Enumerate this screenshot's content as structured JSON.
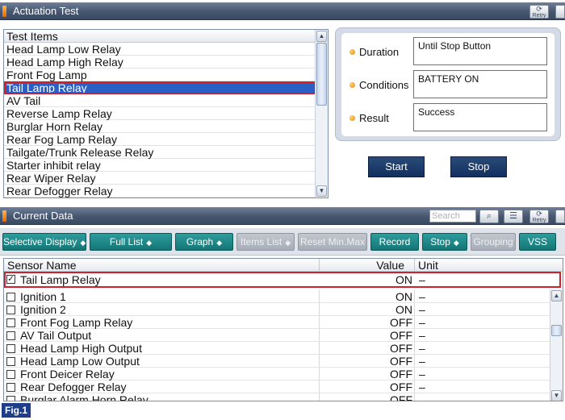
{
  "actuation": {
    "title": "Actuation Test",
    "retry_label": "Retry",
    "list_header": "Test Items",
    "items": [
      "Head Lamp Low Relay",
      "Head Lamp High Relay",
      "Front Fog Lamp",
      "Tail Lamp Relay",
      "AV Tail",
      "Reverse Lamp Relay",
      "Burglar Horn Relay",
      "Rear Fog Lamp Relay",
      "Tailgate/Trunk Release Relay",
      "Starter inhibit relay",
      "Rear Wiper Relay",
      "Rear Defogger Relay"
    ],
    "selected_index": 3,
    "duration_label": "Duration",
    "duration_value": "Until Stop Button",
    "conditions_label": "Conditions",
    "conditions_value": "BATTERY ON",
    "result_label": "Result",
    "result_value": "Success",
    "start_label": "Start",
    "stop_label": "Stop"
  },
  "current_data": {
    "title": "Current Data",
    "search_placeholder": "Search",
    "retry_label": "Retry",
    "toolbar": {
      "selective_display": "Selective Display",
      "full_list": "Full List",
      "graph": "Graph",
      "items_list": "Items List",
      "reset_min_max": "Reset Min.Max",
      "record": "Record",
      "stop": "Stop",
      "grouping": "Grouping",
      "vss": "VSS"
    },
    "columns": {
      "name": "Sensor Name",
      "value": "Value",
      "unit": "Unit"
    },
    "pinned": {
      "name": "Tail Lamp Relay",
      "value": "ON",
      "unit": "–",
      "checked": true
    },
    "rows": [
      {
        "name": "Ignition 1",
        "value": "ON",
        "unit": "–"
      },
      {
        "name": "Ignition 2",
        "value": "ON",
        "unit": "–"
      },
      {
        "name": "Front Fog Lamp Relay",
        "value": "OFF",
        "unit": "–"
      },
      {
        "name": "AV Tail Output",
        "value": "OFF",
        "unit": "–"
      },
      {
        "name": "Head Lamp High Output",
        "value": "OFF",
        "unit": "–"
      },
      {
        "name": "Head Lamp Low Output",
        "value": "OFF",
        "unit": "–"
      },
      {
        "name": "Front Deicer Relay",
        "value": "OFF",
        "unit": "–"
      },
      {
        "name": "Rear Defogger Relay",
        "value": "OFF",
        "unit": "–"
      },
      {
        "name": "Burglar Alarm Horn Relay",
        "value": "OFF",
        "unit": "–"
      }
    ]
  },
  "figure_label": "Fig.1",
  "colors": {
    "titlebar": "#46566e",
    "selection": "#2a5fc6",
    "highlight_outline": "#d0202a",
    "teal_button": "#147575",
    "action_button": "#123060"
  }
}
